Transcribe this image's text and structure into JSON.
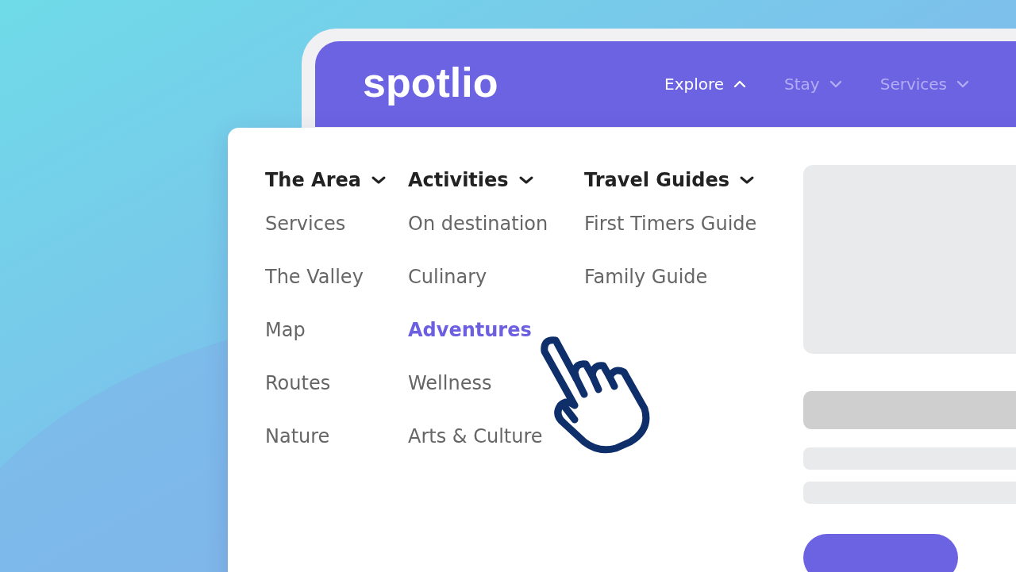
{
  "logo": "spotlio",
  "nav": [
    {
      "label": "Explore",
      "expanded": true
    },
    {
      "label": "Stay",
      "expanded": false
    },
    {
      "label": "Services",
      "expanded": false
    }
  ],
  "menu_columns": [
    {
      "heading": "The Area",
      "items": [
        {
          "label": "Services",
          "selected": false
        },
        {
          "label": "The Valley",
          "selected": false
        },
        {
          "label": "Map",
          "selected": false
        },
        {
          "label": "Routes",
          "selected": false
        },
        {
          "label": "Nature",
          "selected": false
        }
      ]
    },
    {
      "heading": "Activities",
      "items": [
        {
          "label": "On destination",
          "selected": false
        },
        {
          "label": "Culinary",
          "selected": false
        },
        {
          "label": "Adventures",
          "selected": true
        },
        {
          "label": "Wellness",
          "selected": false
        },
        {
          "label": "Arts & Culture",
          "selected": false
        }
      ]
    },
    {
      "heading": "Travel Guides",
      "items": [
        {
          "label": "First Timers Guide",
          "selected": false
        },
        {
          "label": "Family Guide",
          "selected": false
        }
      ]
    }
  ]
}
